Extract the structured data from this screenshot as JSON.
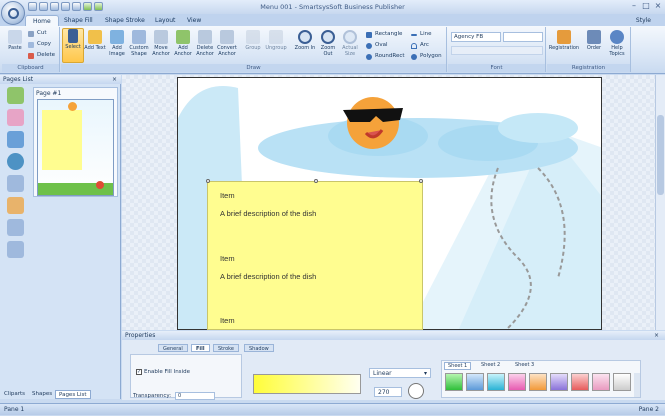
{
  "app": {
    "title": "Menu 001 - SmartsysSoft Business Publisher",
    "style_label": "Style"
  },
  "tabs": [
    "Home",
    "Shape Fill",
    "Shape Stroke",
    "Layout",
    "View"
  ],
  "ribbon": {
    "clipboard": {
      "label": "Clipboard",
      "paste": "Paste",
      "cut": "Cut",
      "copy": "Copy",
      "delete": "Delete"
    },
    "draw": {
      "label": "Draw",
      "buttons": [
        "Select",
        "Add Text",
        "Add Image",
        "Custom Shape",
        "Move Anchor",
        "Add Anchor",
        "Delete Anchor",
        "Convert Anchor",
        "Group",
        "Ungroup",
        "Zoom In",
        "Zoom Out",
        "Actual Size"
      ],
      "shapes": [
        "Rectangle",
        "Oval",
        "RoundRect",
        "Line",
        "Arc",
        "Polygon"
      ]
    },
    "font": {
      "label": "Font",
      "font_name": "Agency FB"
    },
    "registration": {
      "label": "Registration",
      "buttons": [
        "Registration",
        "Order",
        "Help Topics"
      ]
    }
  },
  "pages_panel": {
    "title": "Pages List",
    "page_label": "Page #1",
    "bottom_tabs": [
      "Cliparts",
      "Shapes",
      "Pages List"
    ]
  },
  "canvas": {
    "items": [
      {
        "name": "Item",
        "desc": "A brief description of the dish"
      },
      {
        "name": "Item",
        "desc": "A brief description of the dish"
      },
      {
        "name": "Item"
      }
    ]
  },
  "properties": {
    "title": "Properties",
    "tabs": [
      "General",
      "Fill",
      "Stroke",
      "Shadow"
    ],
    "enable_fill": "Enable Fill Inside",
    "transparency_label": "Transparency:",
    "transparency_value": "0",
    "gradient_type": "Linear",
    "angle": "270",
    "sheets": [
      "Sheet 1",
      "Sheet 2",
      "Sheet 3"
    ]
  },
  "status": {
    "left": "Pane 1",
    "right": "Pane 2"
  },
  "colors": {
    "accent": "#1e395b",
    "note": "#fffd90",
    "sky": "#9fd8f2"
  }
}
